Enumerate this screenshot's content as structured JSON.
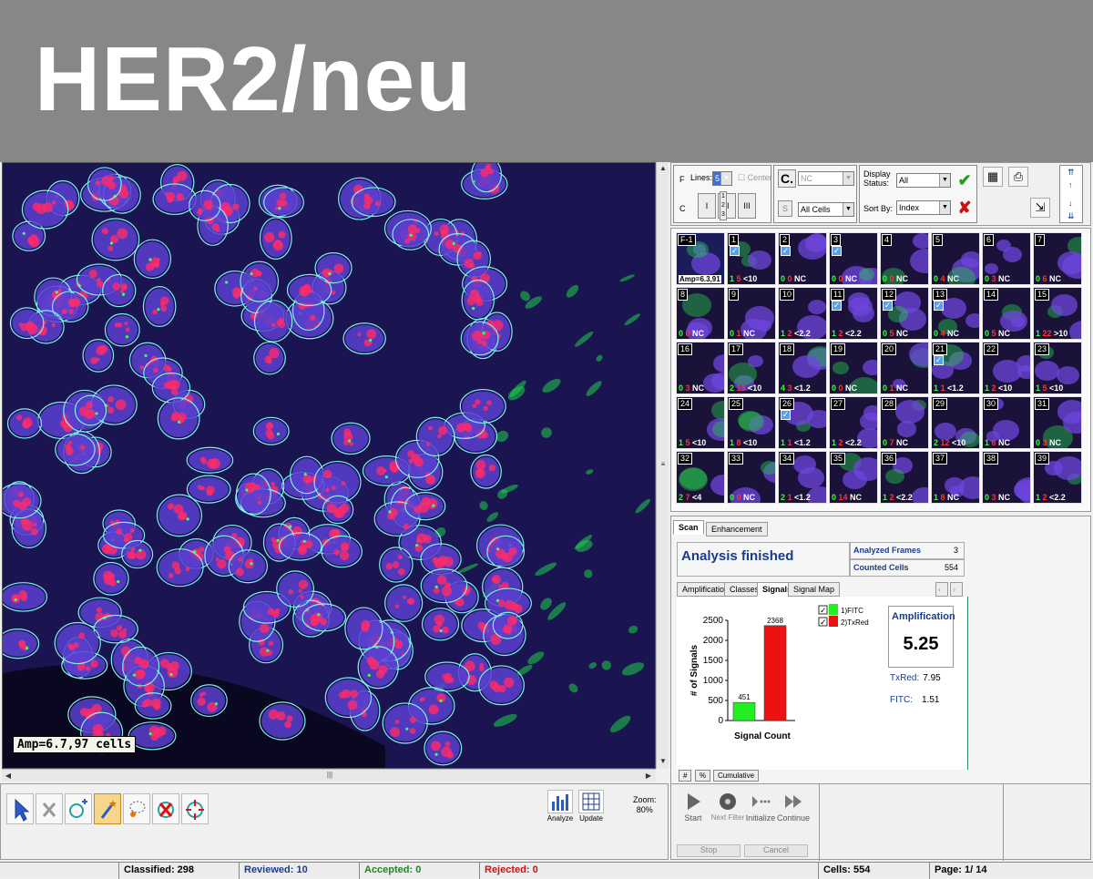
{
  "banner": {
    "title": "HER2/neu"
  },
  "image_view": {
    "overlay_label": "Amp=6.7,97 cells"
  },
  "toolbar": {
    "f_label": "F",
    "c_label": "C",
    "lines_label": "Lines:",
    "lines_value": "5",
    "center_label": "Center",
    "c_button": "C.",
    "nc_value": "NC",
    "s_button": "S",
    "cells_filter": "All Cells",
    "display_status_label": "Display Status:",
    "display_status_value": "All",
    "sort_by_label": "Sort By:",
    "sort_by_value": "Index",
    "roman_1": "I",
    "roman_2": "II",
    "roman_3": "III",
    "stack_label": "1\n2\n3"
  },
  "thumbnails": [
    {
      "num": "F-1",
      "checked": false,
      "green": "",
      "red": "",
      "label": "Amp=6.3,91",
      "special": true
    },
    {
      "num": "1",
      "checked": true,
      "green": "1",
      "red": "5",
      "label": "<10"
    },
    {
      "num": "2",
      "checked": true,
      "green": "0",
      "red": "0",
      "label": "NC"
    },
    {
      "num": "3",
      "checked": true,
      "green": "0",
      "red": "0",
      "label": "NC"
    },
    {
      "num": "4",
      "checked": false,
      "green": "0",
      "red": "0",
      "label": "NC"
    },
    {
      "num": "5",
      "checked": false,
      "green": "0",
      "red": "4",
      "label": "NC"
    },
    {
      "num": "6",
      "checked": false,
      "green": "0",
      "red": "3",
      "label": "NC"
    },
    {
      "num": "7",
      "checked": false,
      "green": "0",
      "red": "6",
      "label": "NC"
    },
    {
      "num": "8",
      "checked": false,
      "green": "0",
      "red": "0",
      "label": "NC"
    },
    {
      "num": "9",
      "checked": false,
      "green": "0",
      "red": "1",
      "label": "NC"
    },
    {
      "num": "10",
      "checked": false,
      "green": "1",
      "red": "2",
      "label": "<2.2"
    },
    {
      "num": "11",
      "checked": true,
      "green": "1",
      "red": "2",
      "label": "<2.2"
    },
    {
      "num": "12",
      "checked": true,
      "green": "0",
      "red": "5",
      "label": "NC"
    },
    {
      "num": "13",
      "checked": true,
      "green": "0",
      "red": "4",
      "label": "NC"
    },
    {
      "num": "14",
      "checked": false,
      "green": "0",
      "red": "5",
      "label": "NC"
    },
    {
      "num": "15",
      "checked": false,
      "green": "1",
      "red": "22",
      "label": ">10"
    },
    {
      "num": "16",
      "checked": false,
      "green": "0",
      "red": "3",
      "label": "NC"
    },
    {
      "num": "17",
      "checked": false,
      "green": "2",
      "red": "19",
      "label": "<10"
    },
    {
      "num": "18",
      "checked": false,
      "green": "4",
      "red": "3",
      "label": "<1.2"
    },
    {
      "num": "19",
      "checked": false,
      "green": "0",
      "red": "0",
      "label": "NC"
    },
    {
      "num": "20",
      "checked": false,
      "green": "0",
      "red": "1",
      "label": "NC"
    },
    {
      "num": "21",
      "checked": true,
      "green": "1",
      "red": "1",
      "label": "<1.2"
    },
    {
      "num": "22",
      "checked": false,
      "green": "1",
      "red": "2",
      "label": "<10"
    },
    {
      "num": "23",
      "checked": false,
      "green": "1",
      "red": "5",
      "label": "<10"
    },
    {
      "num": "24",
      "checked": false,
      "green": "1",
      "red": "5",
      "label": "<10"
    },
    {
      "num": "25",
      "checked": false,
      "green": "1",
      "red": "8",
      "label": "<10"
    },
    {
      "num": "26",
      "checked": true,
      "green": "1",
      "red": "1",
      "label": "<1.2"
    },
    {
      "num": "27",
      "checked": false,
      "green": "1",
      "red": "2",
      "label": "<2.2"
    },
    {
      "num": "28",
      "checked": false,
      "green": "0",
      "red": "7",
      "label": "NC"
    },
    {
      "num": "29",
      "checked": false,
      "green": "2",
      "red": "12",
      "label": "<10"
    },
    {
      "num": "30",
      "checked": false,
      "green": "1",
      "red": "6",
      "label": "NC"
    },
    {
      "num": "31",
      "checked": false,
      "green": "0",
      "red": "3",
      "label": "NC"
    },
    {
      "num": "32",
      "checked": false,
      "green": "2",
      "red": "7",
      "label": "<4"
    },
    {
      "num": "33",
      "checked": false,
      "green": "0",
      "red": "0",
      "label": "NC"
    },
    {
      "num": "34",
      "checked": false,
      "green": "2",
      "red": "1",
      "label": "<1.2"
    },
    {
      "num": "35",
      "checked": false,
      "green": "0",
      "red": "14",
      "label": "NC"
    },
    {
      "num": "36",
      "checked": false,
      "green": "1",
      "red": "2",
      "label": "<2.2"
    },
    {
      "num": "37",
      "checked": false,
      "green": "1",
      "red": "8",
      "label": "NC"
    },
    {
      "num": "38",
      "checked": false,
      "green": "0",
      "red": "3",
      "label": "NC"
    },
    {
      "num": "39",
      "checked": false,
      "green": "1",
      "red": "2",
      "label": "<2.2"
    }
  ],
  "analysis": {
    "tabs_top": [
      "Scan",
      "Enhancement"
    ],
    "status": "Analysis finished",
    "analyzed_frames_label": "Analyzed Frames",
    "analyzed_frames_value": "3",
    "counted_cells_label": "Counted Cells",
    "counted_cells_value": "554",
    "tabs": [
      "Amplification",
      "Classes",
      "Signals",
      "Signal Map"
    ],
    "amplification_label": "Amplification",
    "amplification_value": "5.25",
    "txred_label": "TxRed:",
    "txred_value": "7.95",
    "fitc_label": "FITC:",
    "fitc_value": "1.51",
    "bottom_tabs": [
      "#",
      "%",
      "Cumulative"
    ]
  },
  "chart_data": {
    "type": "bar",
    "categories": [
      "1)FITC",
      "2)TxRed"
    ],
    "values": [
      451,
      2368
    ],
    "colors": [
      "#22ee22",
      "#ee1111"
    ],
    "xlabel": "Signal Count",
    "ylabel": "# of Signals",
    "ylim": [
      0,
      2500
    ],
    "yticks": [
      0,
      500,
      1000,
      1500,
      2000,
      2500
    ],
    "legend": [
      "1)FITC",
      "2)TxRed"
    ]
  },
  "bottom_toolbar": {
    "analyze_label": "Analyze",
    "update_label": "Update",
    "zoom_label": "Zoom:",
    "zoom_value": "80%"
  },
  "playback": {
    "start": "Start",
    "next_filter": "Next Filter",
    "initialize": "Initialize",
    "continue": "Continue",
    "stop": "Stop",
    "cancel": "Cancel"
  },
  "statusbar": {
    "classified": "Classified: 298",
    "reviewed": "Reviewed: 10",
    "accepted": "Accepted: 0",
    "rejected": "Rejected: 0",
    "cells": "Cells: 554",
    "page": "Page: 1/ 14"
  }
}
